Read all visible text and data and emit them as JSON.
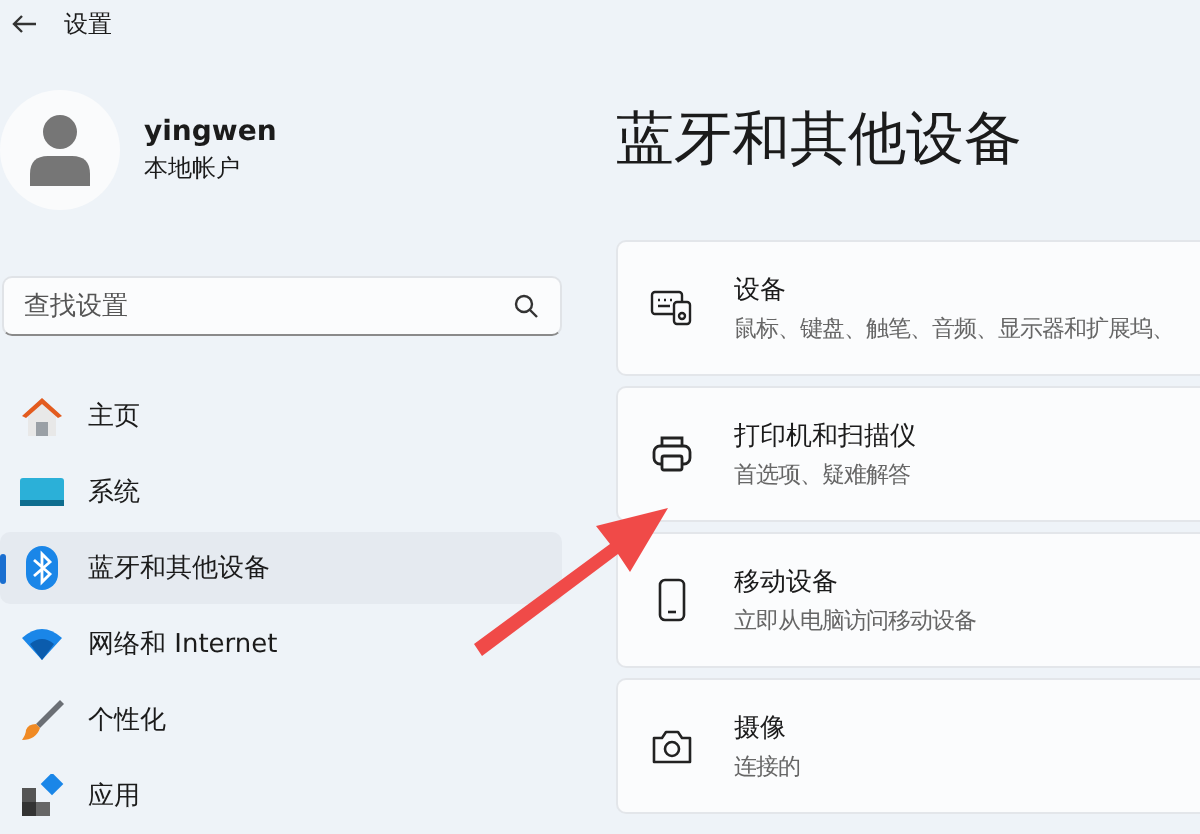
{
  "window": {
    "title": "设置"
  },
  "account": {
    "name": "yingwen",
    "type": "本地帐户"
  },
  "search": {
    "placeholder": "查找设置"
  },
  "nav": [
    {
      "label": "主页",
      "selected": false
    },
    {
      "label": "系统",
      "selected": false
    },
    {
      "label": "蓝牙和其他设备",
      "selected": true
    },
    {
      "label": "网络和 Internet",
      "selected": false
    },
    {
      "label": "个性化",
      "selected": false
    },
    {
      "label": "应用",
      "selected": false
    }
  ],
  "page_title": "蓝牙和其他设备",
  "cards": [
    {
      "title": "设备",
      "subtitle": "鼠标、键盘、触笔、音频、显示器和扩展坞、"
    },
    {
      "title": "打印机和扫描仪",
      "subtitle": "首选项、疑难解答"
    },
    {
      "title": "移动设备",
      "subtitle": "立即从电脑访问移动设备"
    },
    {
      "title": "摄像",
      "subtitle": "连接的"
    }
  ]
}
